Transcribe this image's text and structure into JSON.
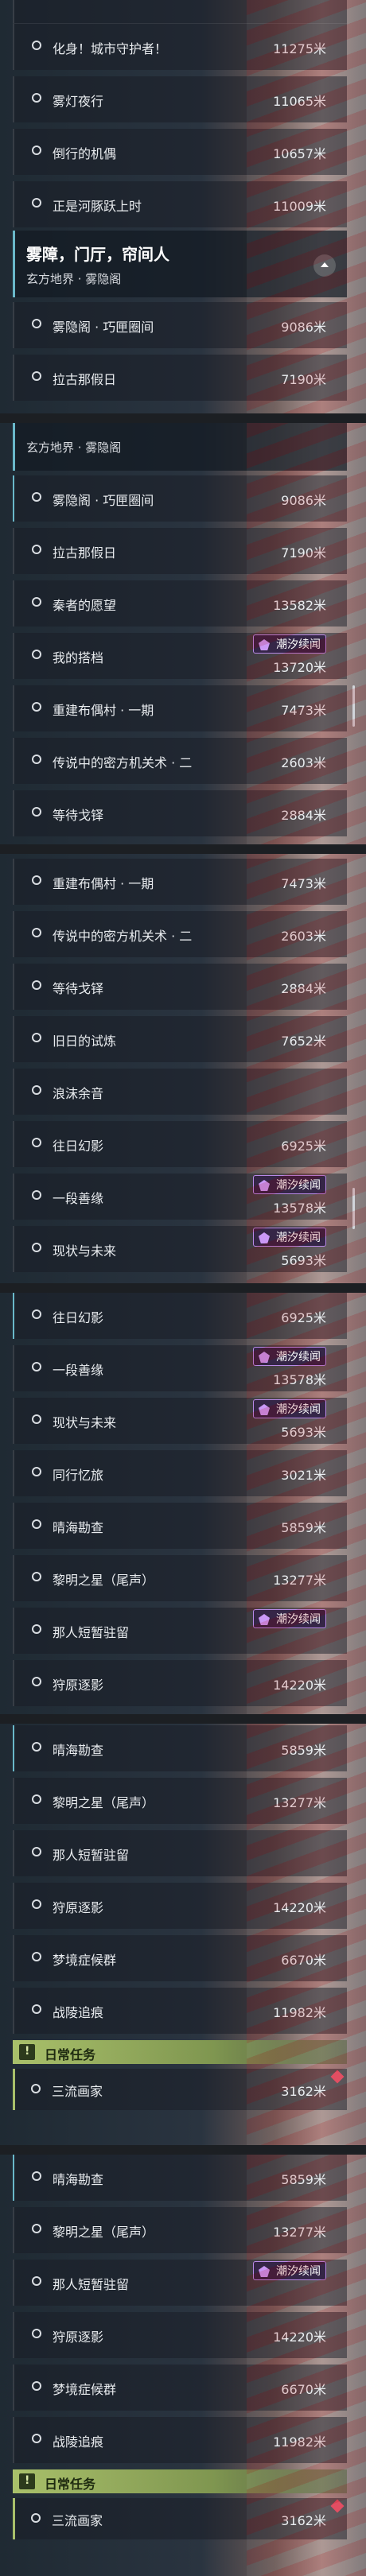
{
  "header": {
    "title": "雾障，门厅，帘间人",
    "subtitle": "玄方地界 · 雾隐阁"
  },
  "tag_label": "潮汐续闻",
  "daily": {
    "label": "日常任务"
  },
  "quests": [
    {
      "name": "化身！城市守护者！",
      "dist": "11275米"
    },
    {
      "name": "雾灯夜行",
      "dist": "11065米"
    },
    {
      "name": "倒行的机偶",
      "dist": "10657米"
    },
    {
      "name": "正是河豚跃上时",
      "dist": "11009米"
    },
    {
      "name": "雾隐阁 · 巧匣圈间",
      "dist": "9086米"
    },
    {
      "name": "拉古那假日",
      "dist": "7190米"
    },
    {
      "name": "秦者的愿望",
      "dist": "13582米"
    },
    {
      "name": "我的搭档",
      "dist": "13720米"
    },
    {
      "name": "重建布偶村 · 一期",
      "dist": "7473米"
    },
    {
      "name": "传说中的密方机关术 · 二",
      "dist": "2603米"
    },
    {
      "name": "等待戈铎",
      "dist": "2884米"
    },
    {
      "name": "旧日的试炼",
      "dist": "7652米"
    },
    {
      "name": "浪沫余音",
      "dist": ""
    },
    {
      "name": "往日幻影",
      "dist": "6925米"
    },
    {
      "name": "一段善缘",
      "dist": "13578米"
    },
    {
      "name": "现状与未来",
      "dist": "5693米"
    },
    {
      "name": "同行忆旅",
      "dist": "3021米"
    },
    {
      "name": "晴海勘查",
      "dist": "5859米"
    },
    {
      "name": "黎明之星（尾声）",
      "dist": "13277米"
    },
    {
      "name": "那人短暂驻留",
      "dist": ""
    },
    {
      "name": "狩原逐影",
      "dist": "14220米"
    },
    {
      "name": "梦境症候群",
      "dist": "6670米"
    },
    {
      "name": "战陵追痕",
      "dist": "11982米"
    },
    {
      "name": "三流画家",
      "dist": "3162米"
    }
  ]
}
